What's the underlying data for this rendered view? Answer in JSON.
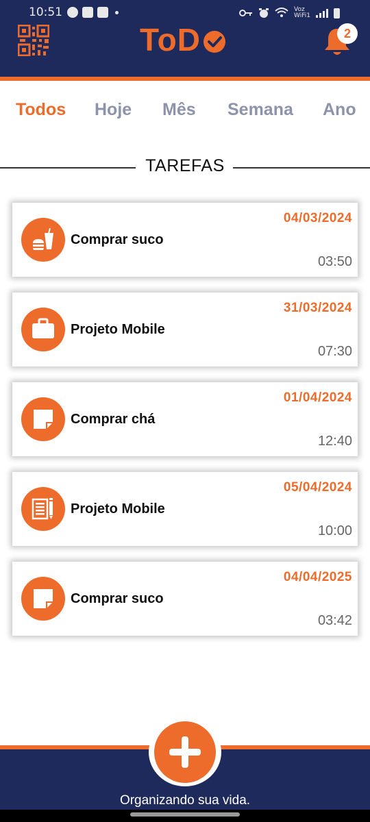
{
  "status_bar": {
    "time": "10:51",
    "network_label_top": "Voz",
    "network_label_bottom": "WiFi1"
  },
  "header": {
    "title": "ToD",
    "notification_count": "2",
    "colors": {
      "background": "#1f2a5c",
      "accent": "#ee6c2b"
    },
    "icons": [
      "qr-code-icon",
      "check-circle-icon",
      "bell-icon"
    ]
  },
  "tabs": [
    {
      "label": "Todos",
      "active": true
    },
    {
      "label": "Hoje",
      "active": false
    },
    {
      "label": "Mês",
      "active": false
    },
    {
      "label": "Semana",
      "active": false
    },
    {
      "label": "Ano",
      "active": false
    }
  ],
  "section": {
    "title": "TAREFAS"
  },
  "tasks": [
    {
      "title": "Comprar suco",
      "date": "04/03/2024",
      "time": "03:50",
      "icon": "food-drink-icon"
    },
    {
      "title": "Projeto Mobile",
      "date": "31/03/2024",
      "time": "07:30",
      "icon": "briefcase-icon"
    },
    {
      "title": "Comprar chá",
      "date": "01/04/2024",
      "time": "12:40",
      "icon": "note-icon"
    },
    {
      "title": "Projeto Mobile",
      "date": "05/04/2024",
      "time": "10:00",
      "icon": "document-pencil-icon"
    },
    {
      "title": "Comprar suco",
      "date": "04/04/2025",
      "time": "03:42",
      "icon": "note-icon"
    }
  ],
  "footer": {
    "tagline": "Organizando sua vida.",
    "add_icon": "plus-icon"
  }
}
